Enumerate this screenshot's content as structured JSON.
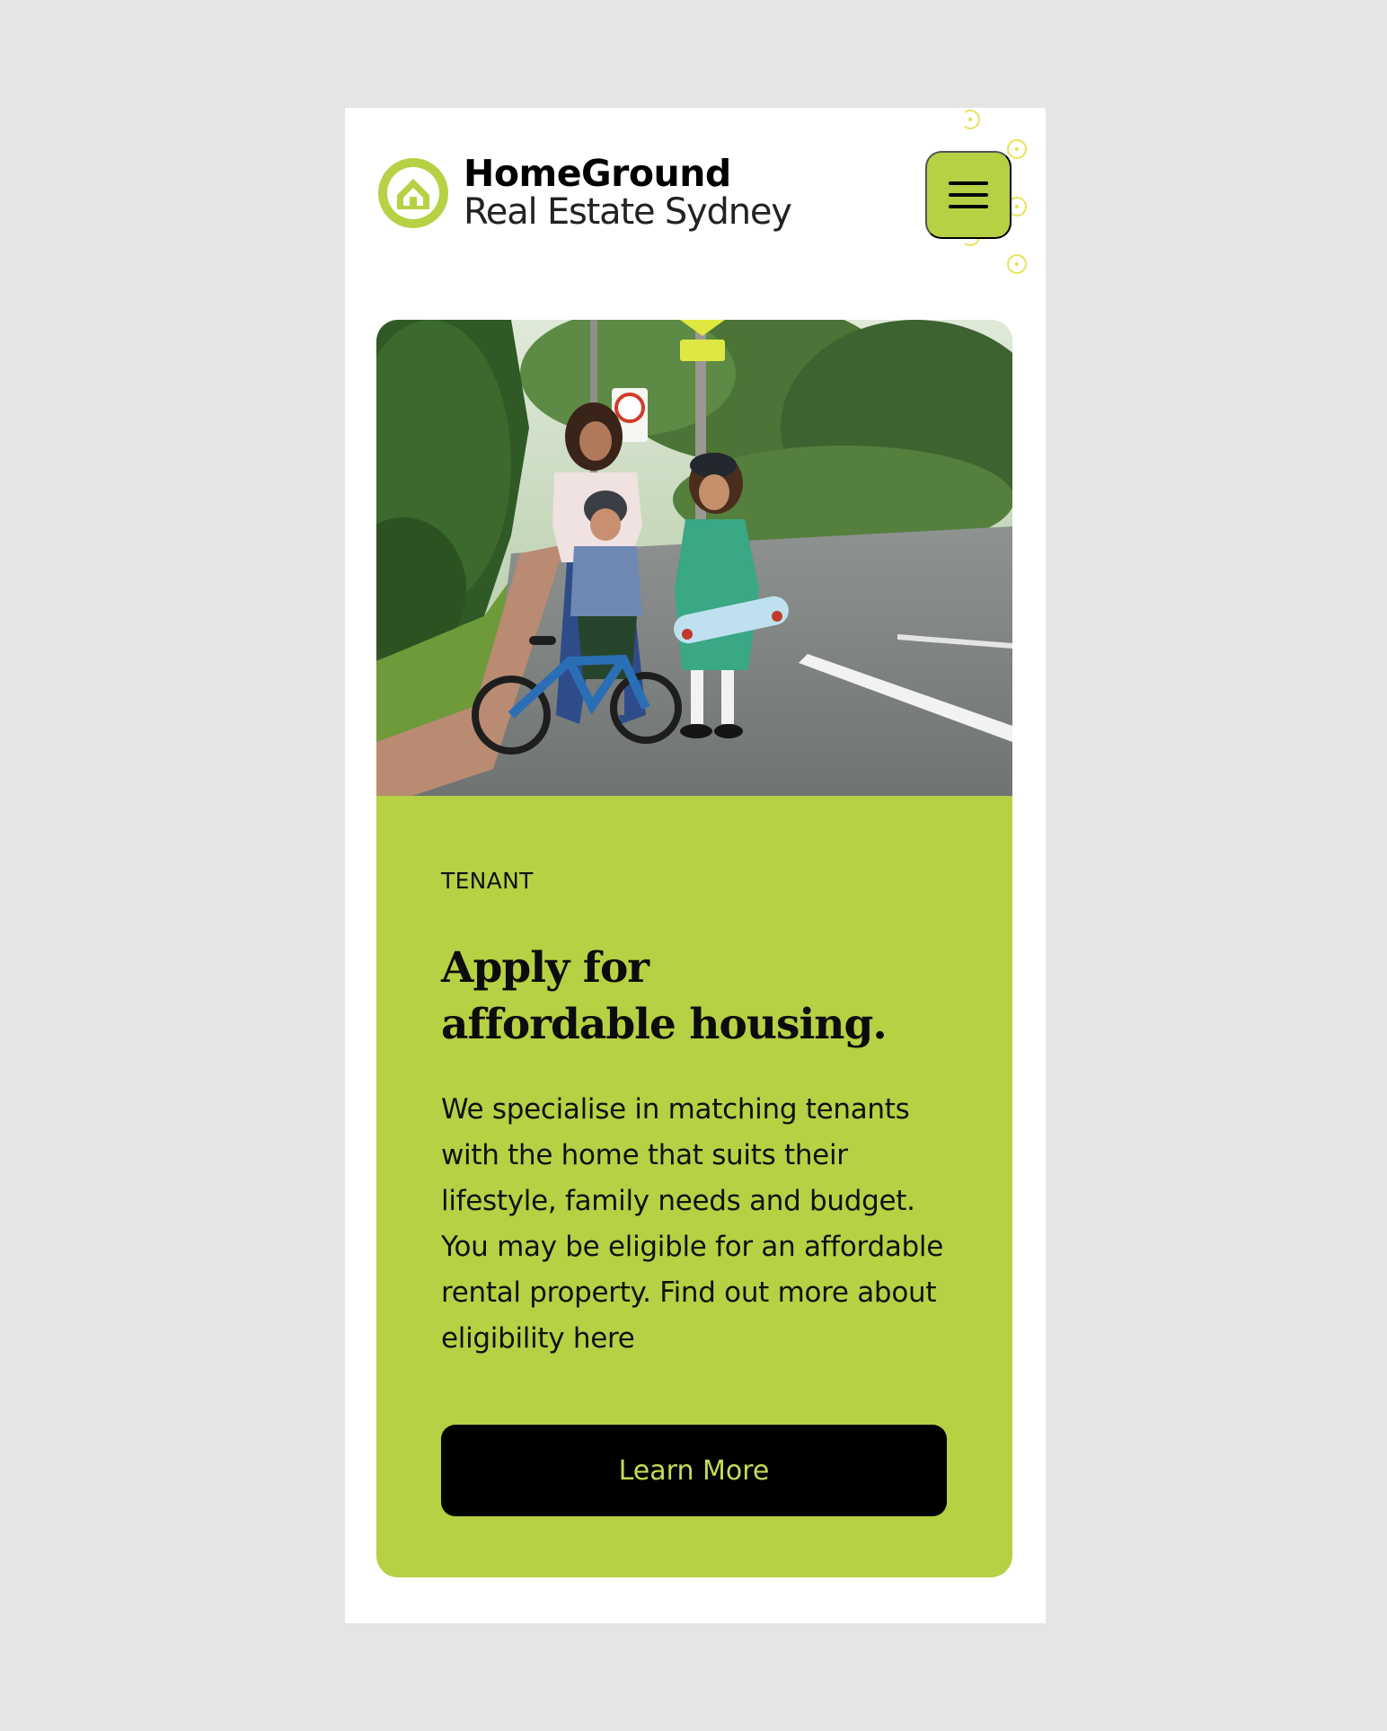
{
  "brand": {
    "title": "HomeGround",
    "subtitle": "Real Estate Sydney",
    "logo_icon": "house-in-circle-icon",
    "accent_color": "#b6d144"
  },
  "header": {
    "menu_icon": "hamburger-menu-icon",
    "decoration_icon": "dotted-circle-pattern"
  },
  "hero": {
    "image_alt": "Mother with two children in school uniforms, one with a bicycle and one holding a skateboard, on a suburban street"
  },
  "card": {
    "eyebrow": "TENANT",
    "heading": "Apply for\naffordable housing.",
    "body": "We specialise in matching tenants with the home that suits their lifestyle, family needs and budget. You may be eligible for an affordable rental property. Find out more about eligibility here",
    "cta_label": "Learn More",
    "background_color": "#b6d144",
    "cta_text_color": "#c3dd55"
  }
}
